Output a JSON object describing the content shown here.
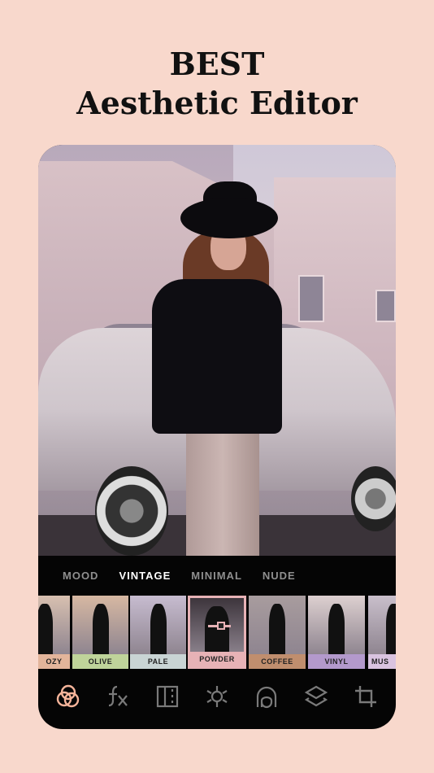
{
  "headline": {
    "line1": "BEST",
    "line2": "Aesthetic Editor"
  },
  "categories": [
    {
      "label": "MOOD",
      "active": false
    },
    {
      "label": "VINTAGE",
      "active": true
    },
    {
      "label": "MINIMAL",
      "active": false
    },
    {
      "label": "NUDE",
      "active": false
    }
  ],
  "filters": [
    {
      "label": "OZY",
      "color": "#e3b59b",
      "tint": "#d8c0b0"
    },
    {
      "label": "OLIVE",
      "color": "#bfd49a",
      "tint": "#d7b8a2"
    },
    {
      "label": "PALE",
      "color": "#c9d4d4",
      "tint": "#c7bcd0"
    },
    {
      "label": "POWDER",
      "color": "#e7b2b6",
      "tint": "#3d353c",
      "selected": true
    },
    {
      "label": "COFFEE",
      "color": "#c08e6e",
      "tint": "#a89c9e"
    },
    {
      "label": "VINYL",
      "color": "#b399cc",
      "tint": "#ddd0d0"
    },
    {
      "label": "MUS",
      "color": "#d9c3e0",
      "tint": "#c9bfcb"
    }
  ],
  "accent": "#f5b49a",
  "tools": [
    "filters-icon",
    "fx-icon",
    "grain-icon",
    "brightness-icon",
    "vignette-icon",
    "layers-icon",
    "crop-icon"
  ]
}
